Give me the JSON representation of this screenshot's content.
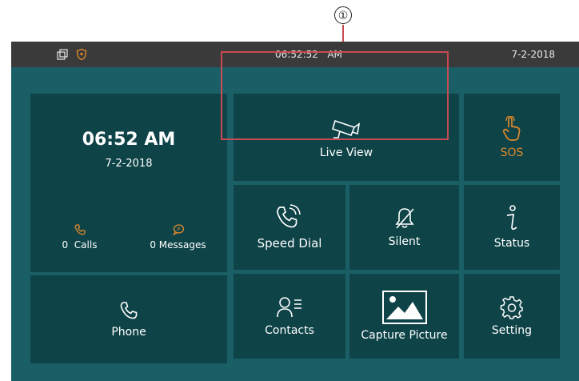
{
  "callout": {
    "number": "①"
  },
  "statusbar": {
    "time": "06:52:52   AM",
    "date": "7-2-2018"
  },
  "left_panel": {
    "time": "06:52 AM",
    "date": "7-2-2018",
    "calls_label": "0  Calls",
    "messages_label": "0 Messages",
    "phone_label": "Phone"
  },
  "tiles": {
    "live_view": "Live View",
    "sos": "SOS",
    "speed_dial": "Speed Dial",
    "silent": "Silent",
    "status": "Status",
    "contacts": "Contacts",
    "capture_picture": "Capture Picture",
    "setting": "Setting"
  },
  "colors": {
    "background": "#1a5f66",
    "tile": "#0e4348",
    "statusbar": "#3a3a3a",
    "accent_orange": "#e08a2a",
    "highlight_red": "#c94a52"
  }
}
